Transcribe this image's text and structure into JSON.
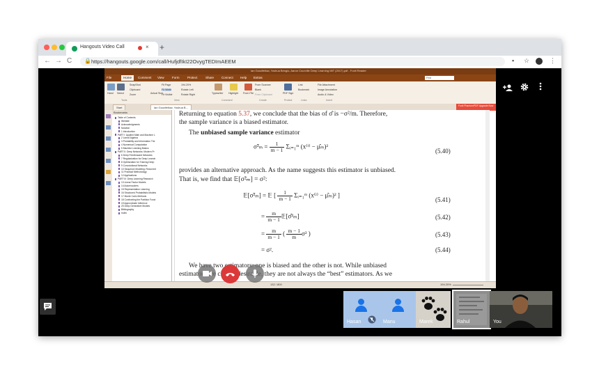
{
  "browser": {
    "tab_title": "Hangouts Video Call",
    "tab_close": "×",
    "new_tab": "+",
    "url": "https://hangouts.google.com/call/HufjdfIkI22OvygTEDImAEEM",
    "lock": "🔒",
    "back": "←",
    "forward": "→",
    "reload": "C",
    "menu": "⋮",
    "star": "☆"
  },
  "reader": {
    "title": "Ian Goodfellow, Yoshua Bengio, Aaron Courville Deep Learning MIT (2017).pdf - Foxit Reader",
    "menus": [
      "File",
      "Home",
      "Comment",
      "View",
      "Form",
      "Protect",
      "Share",
      "Connect",
      "Help",
      "Extras"
    ],
    "active_menu": "Home",
    "ribbon": {
      "hand": "Hand",
      "select": "Select",
      "snapshot": "SnapShot",
      "clipboard": "Clipboard",
      "zoom": "Zoom",
      "actual_size": "Actual Size",
      "fit_page": "Fit Page",
      "fit_width": "Fit Width",
      "fit_visible": "Fit Visible",
      "zoom_pct": "194.20%",
      "rotate_left": "Rotate Left",
      "rotate_right": "Rotate Right",
      "typewriter": "Typewriter",
      "highlight": "Highlight",
      "from_file": "From File",
      "from_scanner": "From Scanner",
      "blank": "Blank",
      "from_clipboard": "From Clipboard",
      "pdf_sign": "PDF Sign",
      "link": "Link",
      "bookmark": "Bookmark",
      "file_attachment": "File Attachment",
      "image_annotation": "Image Annotation",
      "audio_video": "Audio & Video",
      "groups": [
        "Tools",
        "View",
        "Comment",
        "Create",
        "Protect",
        "Links",
        "Insert"
      ],
      "find": "Find"
    },
    "file_tabs": [
      "Start",
      "Ian Goodfellow, Yoshua B..."
    ],
    "promo": "Foxit PhantomPDF Upgrade Now",
    "bookmarks_header": "Bookmarks",
    "bookmarks": [
      "Table of Contents",
      "Website",
      "Acknowledgments",
      "Notation",
      "1 Introduction",
      "PART I: Applied Math and Machine L",
      "2 Linear Algebra",
      "3 Probability and Information The",
      "4 Numerical Computation",
      "5 Machine Learning Basics",
      "PART II: Deep Networks: Modern Pr",
      "6 Deep Feedforward Networks",
      "7 Regularization for Deep Learnin",
      "8 Optimization for Training Deep",
      "9 Convolutional Networks",
      "10 Sequence Modeling: Recurrent",
      "11 Practical Methodology",
      "12 Applications",
      "PART III: Deep Learning Research",
      "13 Linear Factor Models",
      "14 Autoencoders",
      "15 Representation Learning",
      "16 Structured Probabilistic Models",
      "17 Monte Carlo Methods",
      "18 Confronting the Partition Funct",
      "19 Approximate Inference",
      "20 Deep Generative Models",
      "Bibliography",
      "Index"
    ],
    "doc": {
      "line1a": "Returning to equation ",
      "line1ref": "5.37",
      "line1b": ", we conclude that the bias of σ̂",
      "line1c": " is −σ²/m. Therefore,",
      "line2": "the sample variance is a biased estimator.",
      "line3a": "The ",
      "line3b": "unbiased sample variance",
      "line3c": " estimator",
      "eq540_lhs": "σ̃²ₘ = ",
      "eq540_num": "1",
      "eq540_den": "m − 1",
      "eq540_rhs": "Σᵢ₌₁ᵐ (x⁽ⁱ⁾ − μ̂ₘ)²",
      "eq540_no": "(5.40)",
      "para1": "provides an alternative approach. As the name suggests this estimator is unbiased.",
      "para2": "That is, we find that 𝔼[σ̃²ₘ] = σ²:",
      "eq541_lhs": "𝔼[σ̃²ₘ] = 𝔼",
      "eq541_rhs": "Σᵢ₌₁ᵐ (x⁽ⁱ⁾ − μ̂ₘ)²",
      "eq541_no": "(5.41)",
      "eq542_lhs": "=",
      "eq542_num": "m",
      "eq542_rhs": "𝔼[σ̂²ₘ]",
      "eq542_no": "(5.42)",
      "eq543_no": "(5.43)",
      "eq543_inner_num": "m − 1",
      "eq543_inner_den": "m",
      "eq543_tail": "σ²",
      "eq544": "= σ².",
      "eq544_no": "(5.44)",
      "tail1": "We have two estimators: one is biased and the other is not. While unbiased",
      "tail2": "estimators are clearly desirable, they are not always the “best” estimators. As we"
    },
    "status_page": "132 / 800",
    "status_zoom": "194.20%"
  },
  "participants": [
    {
      "name": "Hasan"
    },
    {
      "name": "Manu"
    },
    {
      "name": "Marek"
    },
    {
      "name": "Rahul"
    },
    {
      "name": "You"
    }
  ],
  "colors": {
    "reader_brand": "#8b4515",
    "hangup": "#db3939",
    "avatar_bg": "#a9c6ea"
  },
  "icons": {
    "add_person": "person-add-icon",
    "settings": "gear-icon",
    "more": "more-vert-icon",
    "chat": "chat-icon",
    "hangup": "call-end-icon",
    "camera": "camera-icon",
    "mic": "mic-icon"
  }
}
